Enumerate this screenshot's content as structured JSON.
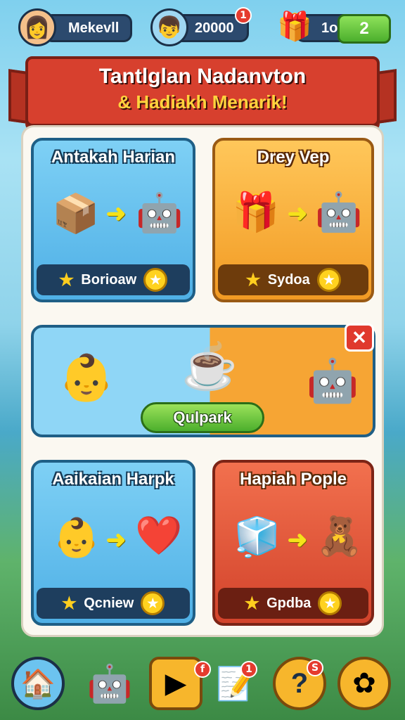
{
  "top_bar": {
    "player_name": "Mekevll",
    "coins": "20000",
    "coins_badge": "1",
    "gift_value": "1o",
    "gift_count": "2"
  },
  "banner": {
    "title": "Tantlglan Nadanvton",
    "subtitle": "& Hadiakh Menarik!"
  },
  "cards": {
    "daily": {
      "title": "Antakah Harian",
      "bar_label": "Borioaw"
    },
    "drey": {
      "title": "Drey Vep",
      "bar_label": "Sydoa"
    },
    "harpk": {
      "title": "Aaikaian Harpk",
      "bar_label": "Qcniew"
    },
    "pople": {
      "title": "Hapiah Pople",
      "bar_label": "Gpdba"
    }
  },
  "middle_promo": {
    "button_label": "Qulpark",
    "close_symbol": "✕"
  },
  "bottom_nav": {
    "mail_badge": "f",
    "tasks_badge": "1",
    "help_symbol": "?",
    "help_badge": "S"
  },
  "colors": {
    "banner_red": "#d7402e",
    "card_blue": "#4fb0e6",
    "card_orange": "#f29a23",
    "card_red": "#d2432b",
    "button_green": "#4caf2d"
  }
}
